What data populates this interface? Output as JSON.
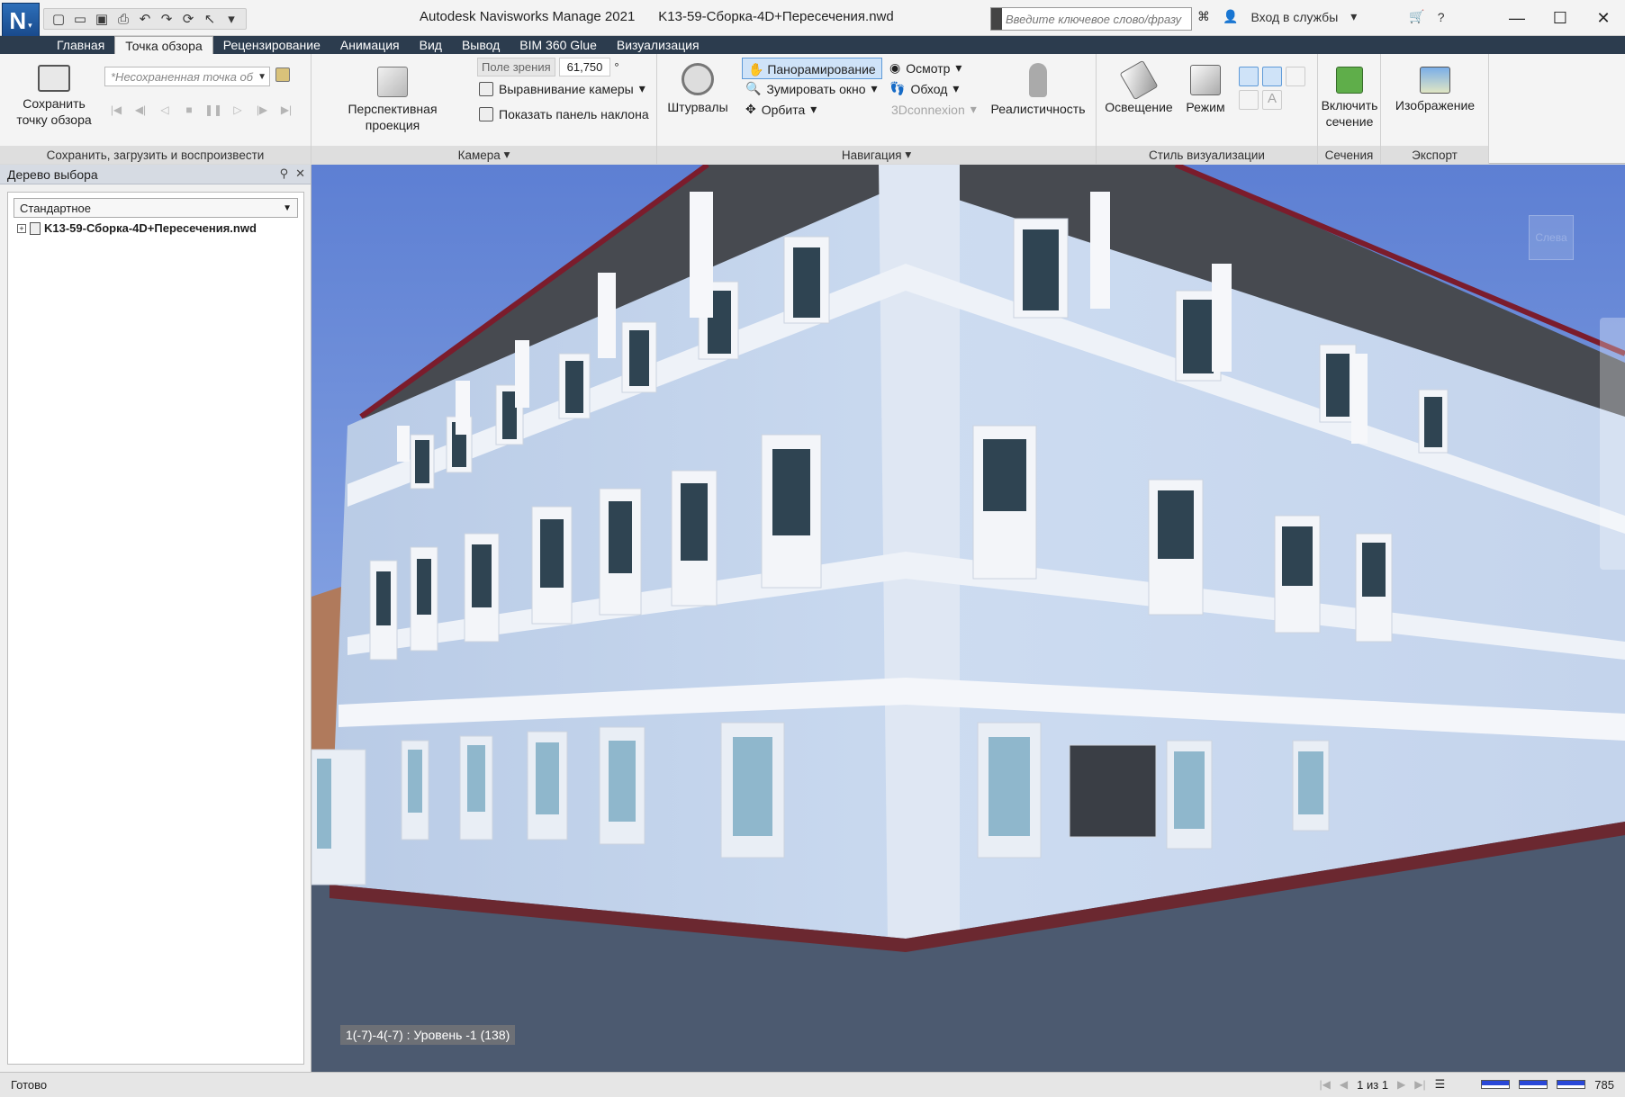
{
  "titlebar": {
    "app_name": "Autodesk Navisworks Manage 2021",
    "file_name": "K13-59-Сборка-4D+Пересечения.nwd",
    "search_placeholder": "Введите ключевое слово/фразу",
    "sign_in": "Вход в службы",
    "app_letter": "N"
  },
  "tabs": [
    "Главная",
    "Точка обзора",
    "Рецензирование",
    "Анимация",
    "Вид",
    "Вывод",
    "BIM 360 Glue",
    "Визуализация"
  ],
  "ribbon": {
    "save_viewpoint": "Сохранить точку обзора",
    "viewpoint_combo": "*Несохраненная точка об",
    "panel_save": "Сохранить, загрузить и воспроизвести",
    "perspective": "Перспективная проекция",
    "fov_label": "Поле зрения",
    "fov_value": "61,750",
    "fov_unit": "°",
    "align_camera": "Выравнивание камеры",
    "show_tilt": "Показать панель наклона",
    "panel_camera": "Камера",
    "steering": "Штурвалы",
    "pan": "Панорамирование",
    "zoom_window": "Зумировать окно",
    "orbit": "Орбита",
    "look_around": "Осмотр",
    "walk": "Обход",
    "connexion": "3Dconnexion",
    "realism": "Реалистичность",
    "panel_navigation": "Навигация",
    "lighting": "Освещение",
    "mode": "Режим",
    "panel_style": "Стиль визуализации",
    "section_enable": "Включить сечение",
    "panel_sections": "Сечения",
    "image": "Изображение",
    "panel_export": "Экспорт"
  },
  "dock": {
    "title": "Дерево выбора",
    "select_value": "Стандартное",
    "tree_root": "K13-59-Сборка-4D+Пересечения.nwd"
  },
  "viewport": {
    "coord_label": "1(-7)-4(-7) : Уровень -1 (138)",
    "viewcube_face": "Слева"
  },
  "status": {
    "ready": "Готово",
    "page": "1 из 1",
    "memory": "785"
  },
  "colors": {
    "sky": "#6e8fd8",
    "facade": "#c8d8ef",
    "ribbon_tab_bg": "#2c3c4e",
    "accent": "#5e9ad8"
  }
}
